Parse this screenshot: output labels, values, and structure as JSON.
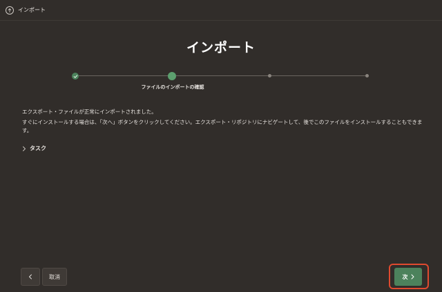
{
  "header": {
    "title": "インポート",
    "icon": "arrow-up-circle-icon"
  },
  "page": {
    "title": "インポート"
  },
  "stepper": {
    "steps": [
      {
        "state": "done"
      },
      {
        "state": "current",
        "label": "ファイルのインポートの確認"
      },
      {
        "state": "future"
      },
      {
        "state": "future"
      }
    ]
  },
  "messages": {
    "success": "エクスポート・ファイルが正常にインポートされました。",
    "instructions": "すぐにインストールする場合は、「次へ」ボタンをクリックしてください。エクスポート・リポジトリにナビゲートして、後でこのファイルをインストールすることもできます。"
  },
  "tasks": {
    "label": "タスク"
  },
  "footer": {
    "cancel_label": "取消",
    "next_label": "次"
  },
  "colors": {
    "background": "#312d2a",
    "accent_green": "#4c825c",
    "highlight_red": "#e04a2f"
  }
}
